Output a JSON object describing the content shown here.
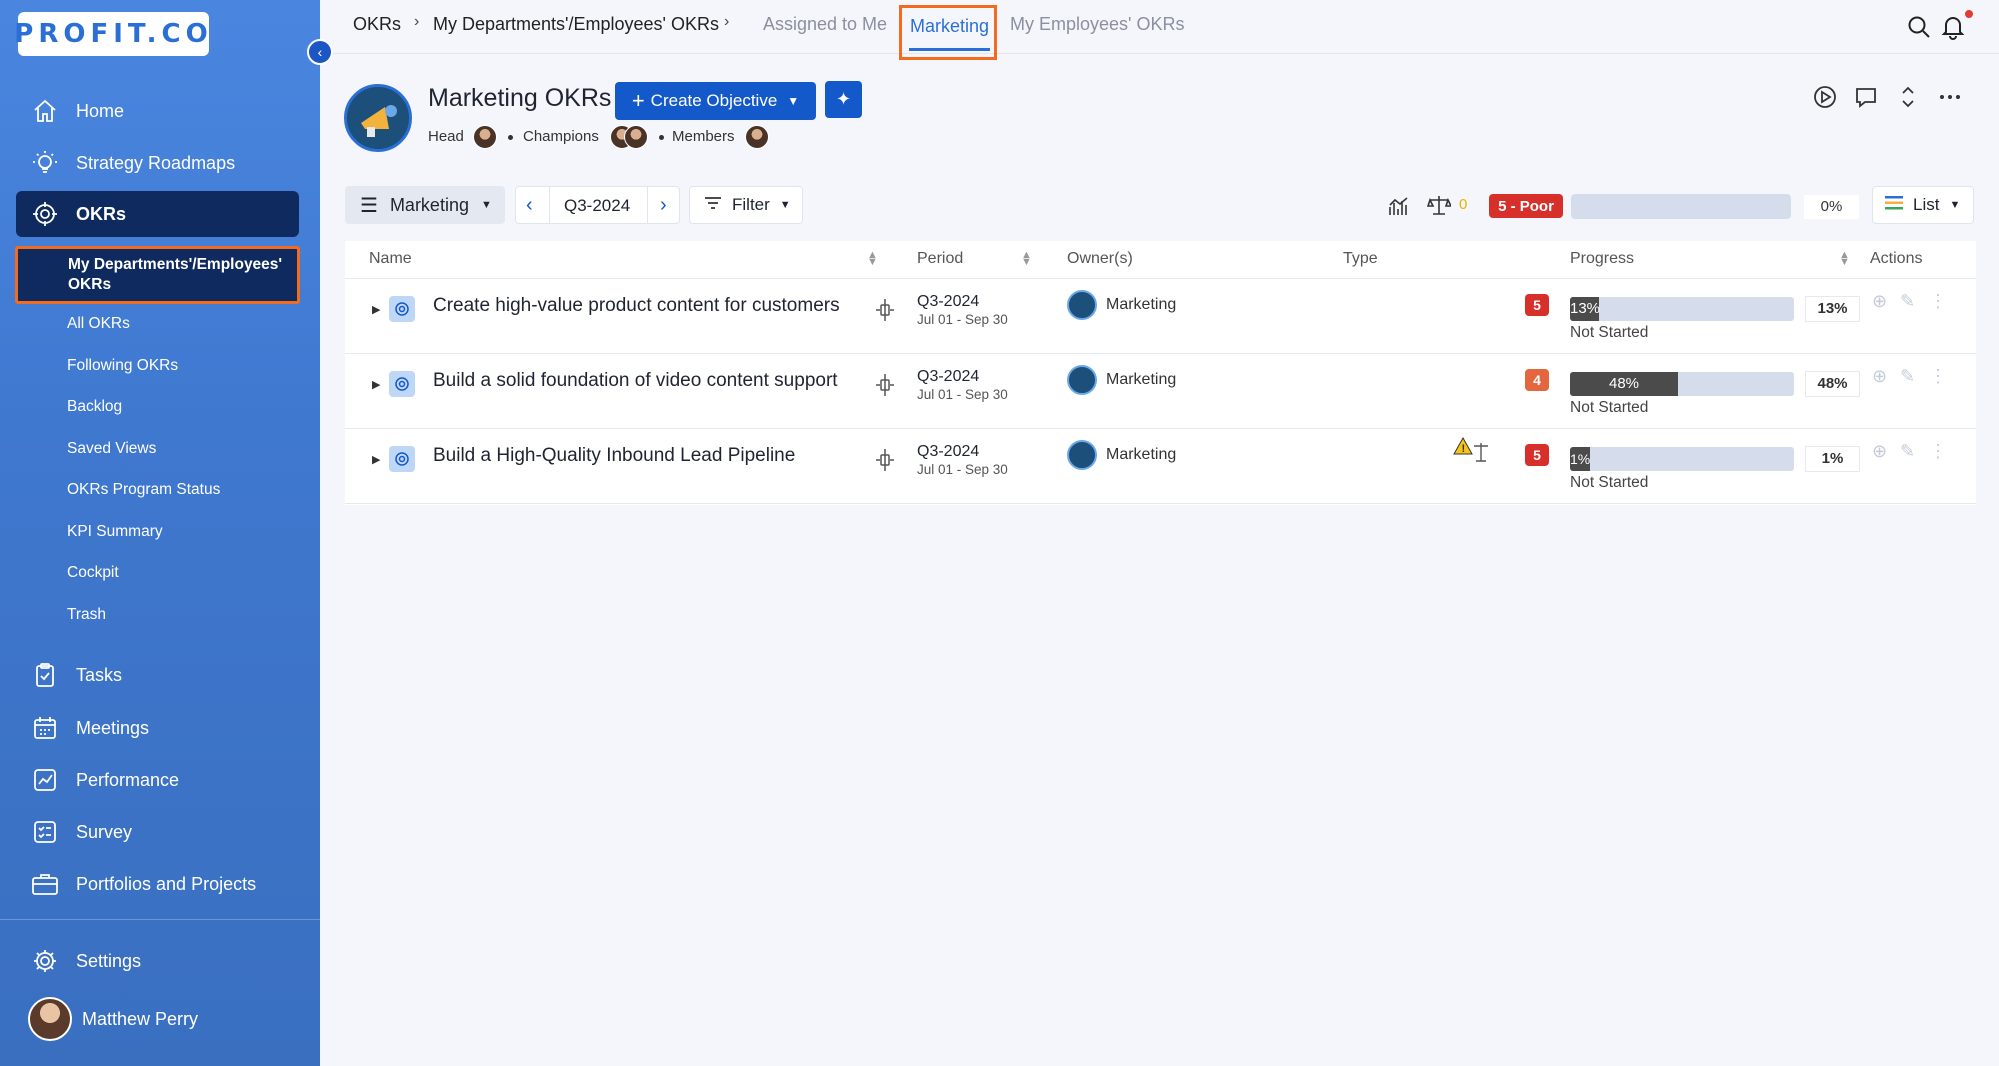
{
  "app": {
    "logo_text": "PROFIT.CO"
  },
  "sidebar": {
    "items": [
      {
        "label": "Home",
        "icon": "home-icon"
      },
      {
        "label": "Strategy Roadmaps",
        "icon": "bulb-icon"
      },
      {
        "label": "OKRs",
        "icon": "target-icon"
      }
    ],
    "okr_sub_active": "My Departments'/Employees' OKRs",
    "okr_sub": [
      "All OKRs",
      "Following OKRs",
      "Backlog",
      "Saved Views",
      "OKRs Program Status",
      "KPI Summary",
      "Cockpit",
      "Trash"
    ],
    "items2": [
      {
        "label": "Tasks",
        "icon": "clipboard-icon"
      },
      {
        "label": "Meetings",
        "icon": "calendar-icon"
      },
      {
        "label": "Performance",
        "icon": "chart-icon"
      },
      {
        "label": "Survey",
        "icon": "survey-icon"
      },
      {
        "label": "Portfolios and Projects",
        "icon": "briefcase-icon"
      }
    ],
    "settings": "Settings",
    "user": "Matthew Perry"
  },
  "topbar": {
    "crumbs": [
      "OKRs",
      "My Departments'/Employees' OKRs"
    ],
    "tabs": [
      "Assigned to Me",
      "Marketing",
      "My Employees' OKRs"
    ],
    "active_tab": "Marketing"
  },
  "header": {
    "title": "Marketing OKRs",
    "create_label": "Create Objective",
    "head_label": "Head",
    "champions_label": "Champions",
    "members_label": "Members"
  },
  "toolbar": {
    "team": "Marketing",
    "period": "Q3-2024",
    "filter": "Filter",
    "alignment_count": "0",
    "score_badge": "5 - Poor",
    "overall_progress": "0%",
    "view": "List",
    "overall_progress_value": 0
  },
  "table": {
    "columns": [
      "Name",
      "Period",
      "Owner(s)",
      "Type",
      "Progress",
      "Actions"
    ],
    "rows": [
      {
        "name": "Create high-value product content for customers",
        "period": "Q3-2024",
        "dates": "Jul 01 - Sep 30",
        "owner": "Marketing",
        "score": "5",
        "score_color": "#d7302a",
        "progress": 13,
        "progress_label": "13%",
        "status": "Not Started",
        "warning": false
      },
      {
        "name": "Build a solid foundation of video content support",
        "period": "Q3-2024",
        "dates": "Jul 01 - Sep 30",
        "owner": "Marketing",
        "score": "4",
        "score_color": "#e4663f",
        "progress": 48,
        "progress_label": "48%",
        "status": "Not Started",
        "warning": false
      },
      {
        "name": "Build a High-Quality Inbound Lead Pipeline",
        "period": "Q3-2024",
        "dates": "Jul 01 - Sep 30",
        "owner": "Marketing",
        "score": "5",
        "score_color": "#d7302a",
        "progress": 1,
        "progress_label": "1%",
        "status": "Not Started",
        "warning": true
      }
    ]
  },
  "colors": {
    "accent": "#1459c9",
    "highlight": "#f26c1f",
    "poor": "#d7302a"
  }
}
